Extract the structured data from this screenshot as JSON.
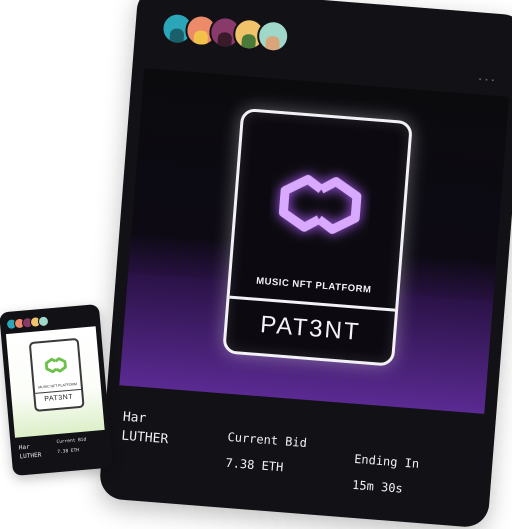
{
  "nft_card": {
    "artwork": {
      "subtitle": "MUSIC NFT PLATFORM",
      "title": "PAT3NT"
    },
    "artist": {
      "first_name": "Har",
      "last_name": "LUTHER"
    },
    "bid": {
      "label": "Current Bid",
      "value": "7.38 ETH"
    },
    "ending": {
      "label": "Ending In",
      "value": "15m 30s"
    },
    "more_menu": "···",
    "colors": {
      "card_bg": "#121216",
      "neon": "#d9a8ff",
      "floor_purple": "#5a2a92",
      "small_logo_green": "#6cc14a"
    },
    "avatar_colors": [
      "#2aa6b8",
      "#ec8a6a",
      "#8a3a6a",
      "#f0c26a",
      "#9fd8c8"
    ]
  },
  "preview_card": {
    "artwork": {
      "subtitle": "MUSIC NFT PLATFORM",
      "title": "PAT3NT"
    },
    "artist": {
      "first_name": "Har",
      "last_name": "LUTHER"
    },
    "bid": {
      "label": "Current Bid",
      "value": "7.38 ETH"
    }
  }
}
